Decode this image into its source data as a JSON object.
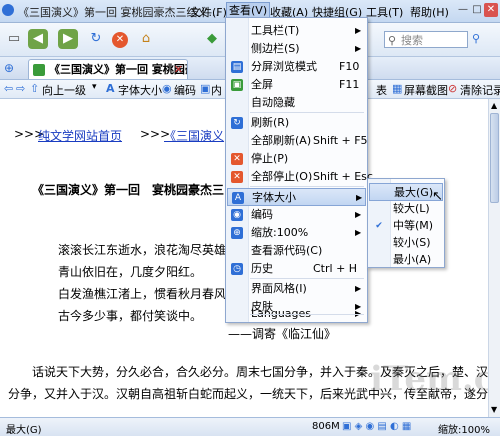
{
  "window": {
    "title": "《三国演义》第一回 宴桃园豪杰三结义...",
    "menus": [
      "文件(F)",
      "查看(V)",
      "收藏(A)",
      "快捷组(G)",
      "工具(T)",
      "帮助(H)"
    ]
  },
  "toolbar": {
    "search_placeholder": "搜索"
  },
  "tab": {
    "label": "《三国演义》第一回 宴桃园豪..."
  },
  "linkbar": {
    "up_label": "向上一级",
    "font_size": "字体大小",
    "encoding": "编码",
    "inner": "内",
    "right_table": "表",
    "screenshot": "屏幕截图",
    "clear": "清除记录"
  },
  "page": {
    "nav_prefix1": ">>>",
    "nav_link1": "纯文学网站首页",
    "nav_prefix2": ">>>",
    "nav_link2": "《三国演义",
    "heading": "《三国演义》第一回　宴桃园豪杰三",
    "poem": [
      "滚滚长江东逝水，浪花淘尽英雄",
      "青山依旧在，几度夕阳红。",
      "白发渔樵江渚上，惯看秋月春风",
      "古今多少事，都付笑谈中。"
    ],
    "poem_source": "——调寄《临江仙》",
    "para1": "话说天下大势，分久必合，合久必分。周末七国分争，并入于秦。及秦灭之后，楚、汉",
    "para2": "分争，又并入于汉。汉朝自高祖斩白蛇而起义，一统天下，后来光武中兴，传至献帝，遂分"
  },
  "view_menu": {
    "items": [
      {
        "label": "工具栏(T)",
        "shortcut": "",
        "submenu": true
      },
      {
        "label": "侧边栏(S)",
        "shortcut": "",
        "submenu": true
      },
      {
        "label": "分屏浏览模式",
        "shortcut": "F10",
        "submenu": false
      },
      {
        "label": "全屏",
        "shortcut": "F11",
        "submenu": false
      },
      {
        "label": "自动隐藏",
        "shortcut": "",
        "submenu": false
      },
      {
        "label": "刷新(R)",
        "shortcut": "",
        "submenu": false
      },
      {
        "label": "全部刷新(A)",
        "shortcut": "Shift + F5",
        "submenu": false
      },
      {
        "label": "停止(P)",
        "shortcut": "",
        "submenu": false
      },
      {
        "label": "全部停止(O)",
        "shortcut": "Shift + Esc",
        "submenu": false
      },
      {
        "label": "字体大小",
        "shortcut": "",
        "submenu": true
      },
      {
        "label": "编码",
        "shortcut": "",
        "submenu": true
      },
      {
        "label": "缩放:100%",
        "shortcut": "",
        "submenu": true
      },
      {
        "label": "查看源代码(C)",
        "shortcut": "",
        "submenu": false
      },
      {
        "label": "历史",
        "shortcut": "Ctrl + H",
        "submenu": false
      },
      {
        "label": "界面风格(I)",
        "shortcut": "",
        "submenu": true
      },
      {
        "label": "皮肤",
        "shortcut": "",
        "submenu": true
      },
      {
        "label": "Languages",
        "shortcut": "",
        "submenu": true
      }
    ]
  },
  "font_menu": {
    "items": [
      "最大(G)",
      "较大(L)",
      "中等(M)",
      "较小(S)",
      "最小(A)"
    ],
    "checked_index": 2
  },
  "statusbar": {
    "zoom_left": "最大(G)",
    "memory": "806M",
    "zoom_right": "缩放:100%"
  },
  "watermark": "iTem.cn"
}
